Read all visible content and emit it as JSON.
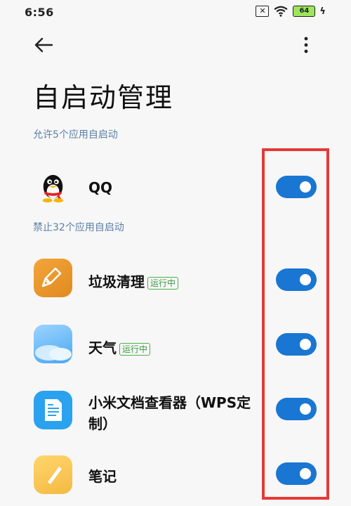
{
  "status": {
    "time": "6:56",
    "battery": "64",
    "sim_icon": "sim-off-icon"
  },
  "header": {
    "title": "自启动管理"
  },
  "sections": {
    "allowed_label": "允许5个应用自启动",
    "denied_label": "禁止32个应用自启动"
  },
  "apps": [
    {
      "name": "QQ",
      "badge": "",
      "enabled": true,
      "icon": "qq-penguin-icon"
    },
    {
      "name": "垃圾清理",
      "badge": "运行中",
      "enabled": true,
      "icon": "broom-icon"
    },
    {
      "name": "天气",
      "badge": "运行中",
      "enabled": true,
      "icon": "cloud-icon"
    },
    {
      "name": "小米文档查看器（WPS定",
      "name2": "制）",
      "badge": "",
      "enabled": true,
      "icon": "document-icon"
    },
    {
      "name": "笔记",
      "badge": "",
      "enabled": true,
      "icon": "pencil-icon"
    }
  ],
  "colors": {
    "toggle_on": "#1976d2",
    "section_label": "#5b7fa6",
    "highlight": "#e53935",
    "running": "#4caf50"
  }
}
